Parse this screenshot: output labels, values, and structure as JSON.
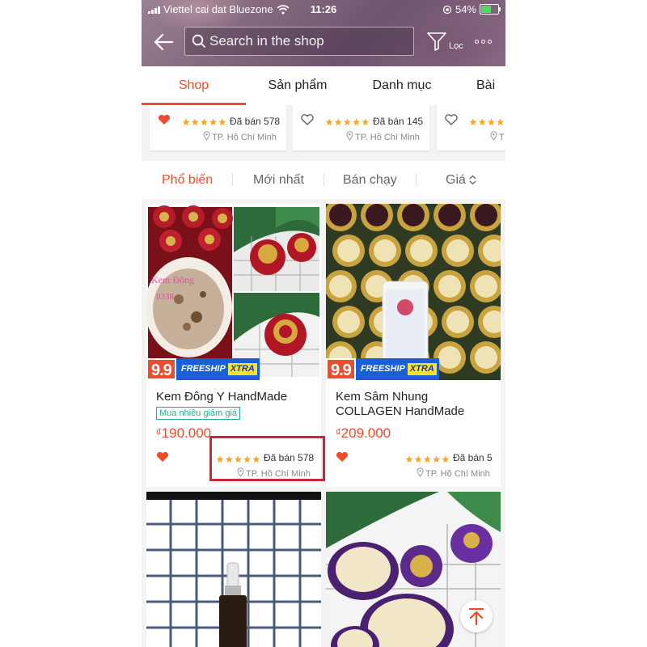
{
  "status_bar": {
    "carrier": "Viettel cai dat Bluezone",
    "time": "11:26",
    "battery_pct": "54%"
  },
  "search": {
    "placeholder": "Search in the shop"
  },
  "filter_label": "Lọc",
  "tabs": [
    {
      "label": "Shop",
      "active": true
    },
    {
      "label": "Sản phẩm"
    },
    {
      "label": "Danh mục"
    },
    {
      "label": "Bài"
    }
  ],
  "mini_cards": [
    {
      "sold": "Đã bán 578",
      "location": "TP. Hồ Chí Minh",
      "liked": true
    },
    {
      "sold": "Đã bán 145",
      "location": "TP. Hồ Chí Minh",
      "liked": false
    },
    {
      "sold": "",
      "location": "T",
      "liked": false
    }
  ],
  "sort": [
    {
      "label": "Phổ biến",
      "active": true
    },
    {
      "label": "Mới nhất"
    },
    {
      "label": "Bán chạy"
    },
    {
      "label": "Giá"
    }
  ],
  "badge": {
    "number": "9.9",
    "freeship": "FREESHIP",
    "xtra": "XTRA"
  },
  "products": [
    {
      "title": "Kem Đông Y HandMade",
      "tag": "Mua nhiều giảm giá",
      "currency": "₫",
      "price": "190.000",
      "sold": "Đã bán 578",
      "location": "TP. Hồ Chí Minh",
      "liked": true,
      "rating": 5
    },
    {
      "title": "Kem Sâm Nhung COLLAGEN HandMade",
      "currency": "₫",
      "price": "209.000",
      "sold": "Đã bán 5",
      "location": "TP. Hồ Chí Minh",
      "liked": true,
      "rating": 5
    }
  ],
  "colors": {
    "accent": "#ee4d2d",
    "star": "#f5a623",
    "highlight": "#d0243a",
    "freeship": "#1b5fd6",
    "xtra": "#f9e22b"
  },
  "icons": [
    "back-arrow-icon",
    "search-icon",
    "filter-icon",
    "more-icon",
    "heart-icon",
    "star-icon",
    "location-pin-icon",
    "sort-arrows-icon",
    "scroll-top-icon"
  ]
}
